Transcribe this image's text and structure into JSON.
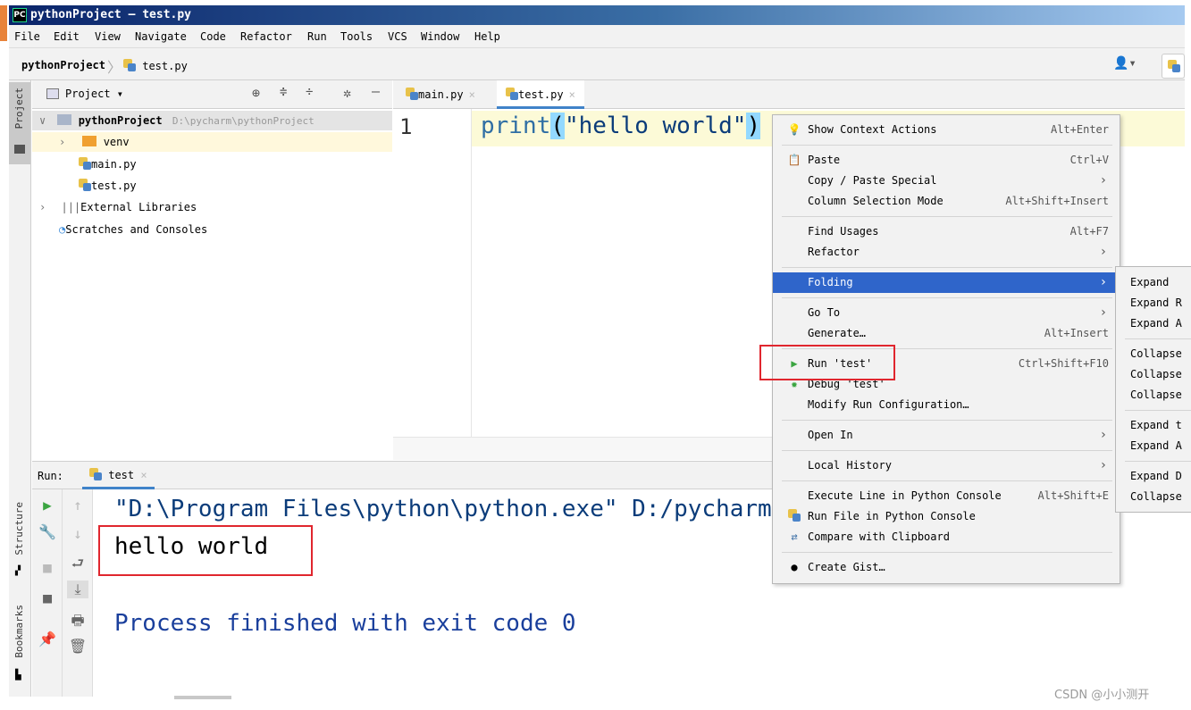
{
  "window": {
    "title": "pythonProject – test.py",
    "app_icon": "PC"
  },
  "menubar": [
    "File",
    "Edit",
    "View",
    "Navigate",
    "Code",
    "Refactor",
    "Run",
    "Tools",
    "VCS",
    "Window",
    "Help"
  ],
  "navbar": {
    "project": "pythonProject",
    "file": "test.py"
  },
  "toolstrip": {
    "project_label": "Project",
    "structure_label": "Structure",
    "bookmarks_label": "Bookmarks"
  },
  "project_panel": {
    "header": "Project",
    "root_name": "pythonProject",
    "root_path": "D:\\pycharm\\pythonProject",
    "items": [
      "venv",
      "main.py",
      "test.py",
      "External Libraries",
      "Scratches and Consoles"
    ]
  },
  "editor": {
    "tabs": [
      {
        "label": "main.py"
      },
      {
        "label": "test.py"
      }
    ],
    "line_number": "1",
    "code": {
      "func": "print",
      "open": "(",
      "string": "\"hello world\"",
      "close": ")"
    }
  },
  "run_panel": {
    "label": "Run:",
    "tab": "test",
    "output": {
      "cmd": "\"D:\\Program Files\\python\\python.exe\" D:/pycharm",
      "hello": "hello world",
      "exit": "Process finished with exit code 0"
    }
  },
  "context_menu": [
    {
      "label": "Show Context Actions",
      "shortcut": "Alt+Enter",
      "icon": "bulb-icon"
    },
    {
      "label": "Paste",
      "shortcut": "Ctrl+V",
      "icon": "clipboard-icon"
    },
    {
      "label": "Copy / Paste Special",
      "submenu": true
    },
    {
      "label": "Column Selection Mode",
      "shortcut": "Alt+Shift+Insert"
    },
    {
      "label": "Find Usages",
      "shortcut": "Alt+F7"
    },
    {
      "label": "Refactor",
      "submenu": true
    },
    {
      "label": "Folding",
      "submenu": true,
      "selected": true
    },
    {
      "label": "Go To",
      "submenu": true
    },
    {
      "label": "Generate…",
      "shortcut": "Alt+Insert"
    },
    {
      "label": "Run 'test'",
      "shortcut": "Ctrl+Shift+F10",
      "icon": "run-icon"
    },
    {
      "label": "Debug 'test'",
      "icon": "debug-icon"
    },
    {
      "label": "Modify Run Configuration…"
    },
    {
      "label": "Open In",
      "submenu": true
    },
    {
      "label": "Local History",
      "submenu": true
    },
    {
      "label": "Execute Line in Python Console",
      "shortcut": "Alt+Shift+E"
    },
    {
      "label": "Run File in Python Console",
      "icon": "python-icon"
    },
    {
      "label": "Compare with Clipboard",
      "icon": "compare-icon"
    },
    {
      "label": "Create Gist…",
      "icon": "github-icon"
    }
  ],
  "folding_submenu": [
    "Expand",
    "Expand R",
    "Expand A",
    "Collapse",
    "Collapse",
    "Collapse",
    "Expand t",
    "Expand A",
    "Expand D",
    "Collapse"
  ],
  "watermark": "CSDN @小小测开",
  "colors": {
    "selection": "#2f65ca",
    "highlight_box": "#e0262e",
    "current_line": "#fcfad7"
  }
}
